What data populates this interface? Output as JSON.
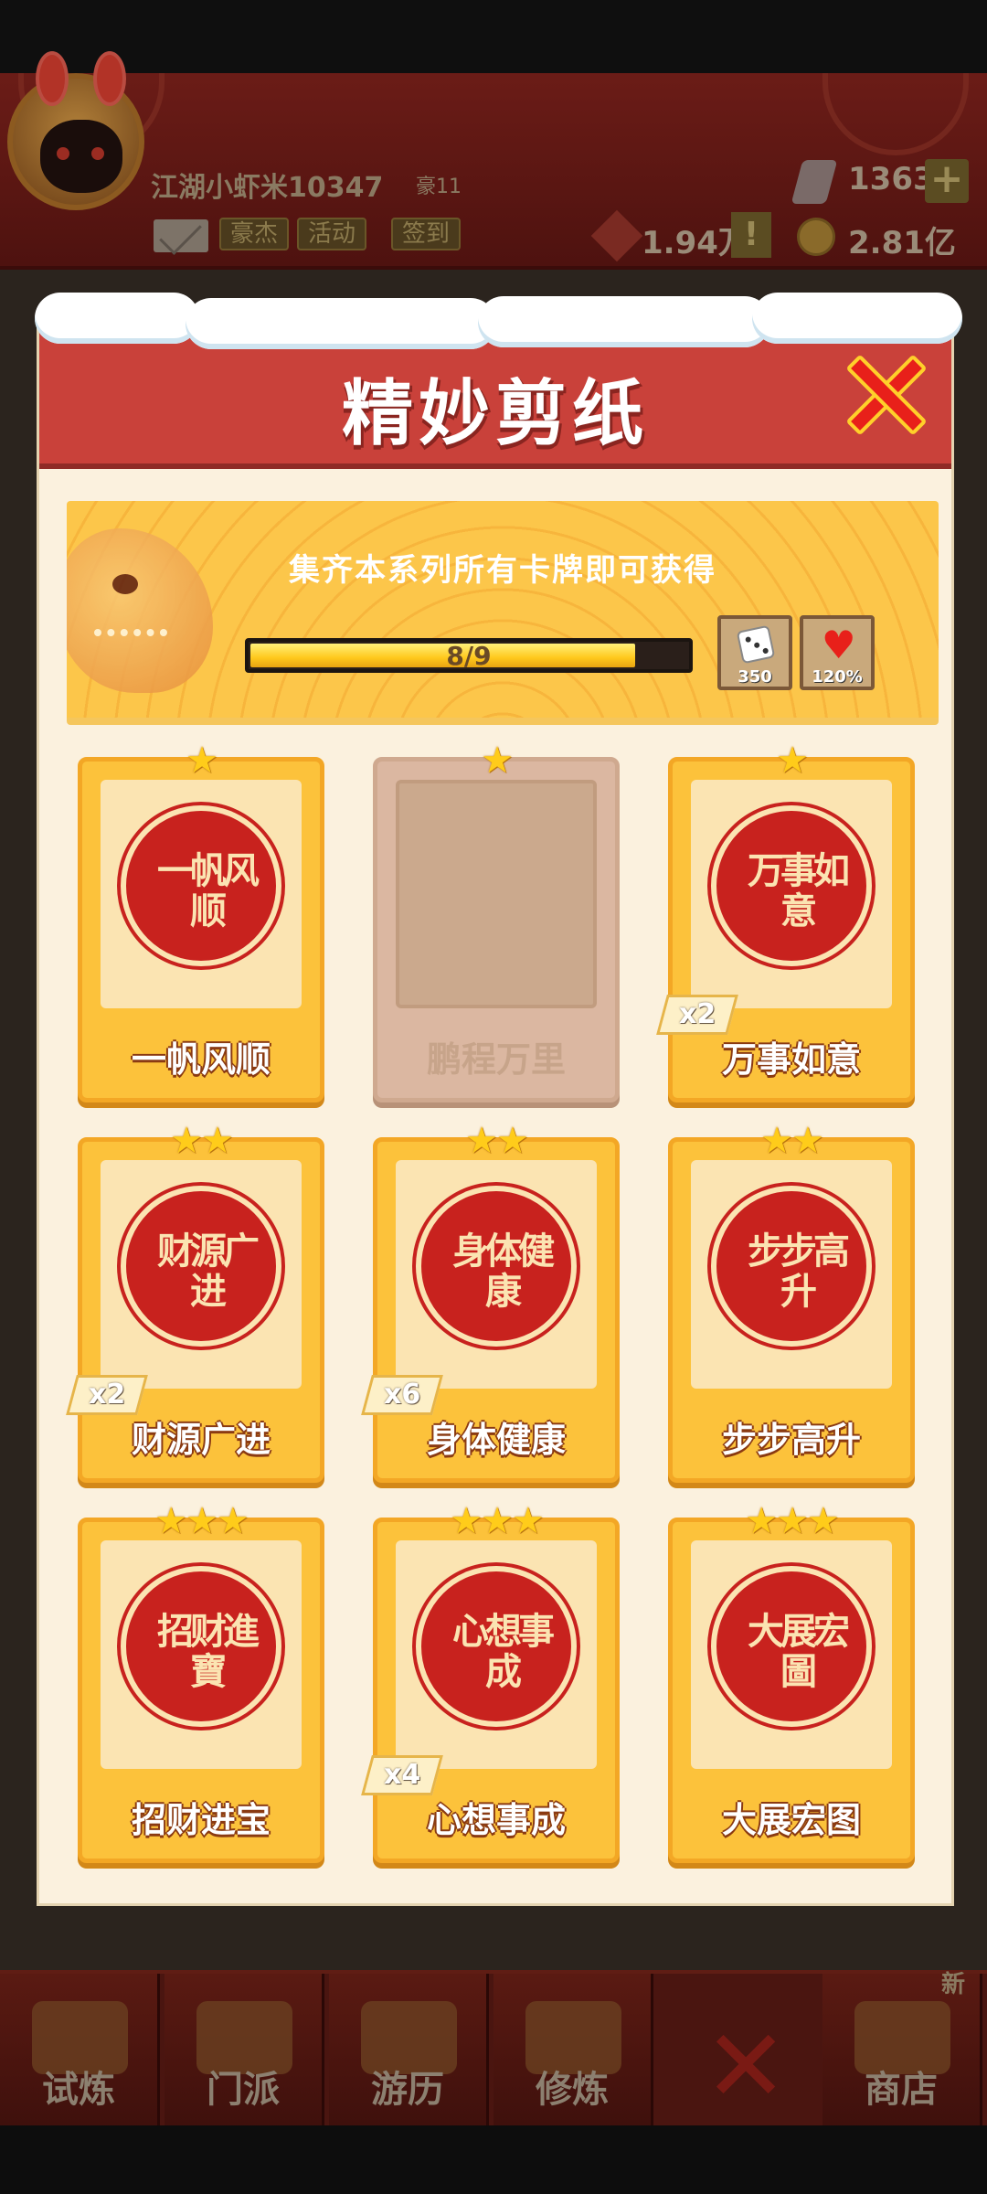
{
  "hud": {
    "player_name": "江湖小虾米10347",
    "player_rank": "豪11",
    "buttons": [
      "豪杰",
      "活动",
      "签到"
    ],
    "gems": "1363",
    "red_currency": "1.94万",
    "gold": "2.81亿",
    "plus_label": "+",
    "warn_label": "!"
  },
  "modal": {
    "title": "精妙剪纸",
    "banner_text": "集齐本系列所有卡牌即可获得",
    "progress": {
      "text": "8/9",
      "current": 8,
      "total": 9
    },
    "rewards": [
      {
        "icon": "dice-icon",
        "label": "350"
      },
      {
        "icon": "heart-icon",
        "label": "120%"
      }
    ],
    "cards": [
      {
        "name": "一帆风顺",
        "stars": 1,
        "glyph": "一帆风顺",
        "dup": "",
        "locked": false
      },
      {
        "name": "鹏程万里",
        "stars": 1,
        "glyph": "",
        "dup": "",
        "locked": true
      },
      {
        "name": "万事如意",
        "stars": 1,
        "glyph": "万事如意",
        "dup": "x2",
        "locked": false
      },
      {
        "name": "财源广进",
        "stars": 2,
        "glyph": "财源广进",
        "dup": "x2",
        "locked": false
      },
      {
        "name": "身体健康",
        "stars": 2,
        "glyph": "身体健康",
        "dup": "x6",
        "locked": false
      },
      {
        "name": "步步高升",
        "stars": 2,
        "glyph": "步步高升",
        "dup": "",
        "locked": false
      },
      {
        "name": "招财进宝",
        "stars": 3,
        "glyph": "招财進寶",
        "dup": "",
        "locked": false
      },
      {
        "name": "心想事成",
        "stars": 3,
        "glyph": "心想事成",
        "dup": "x4",
        "locked": false
      },
      {
        "name": "大展宏图",
        "stars": 3,
        "glyph": "大展宏圖",
        "dup": "",
        "locked": false
      }
    ]
  },
  "bottom_nav": {
    "items": [
      "试炼",
      "门派",
      "游历",
      "修炼",
      "",
      "商店"
    ],
    "new_badge": "新"
  },
  "colors": {
    "header_red": "#c9413a",
    "card_gold": "#fcc23b",
    "papercut_red": "#c8221e",
    "close_red": "#e8201a"
  }
}
